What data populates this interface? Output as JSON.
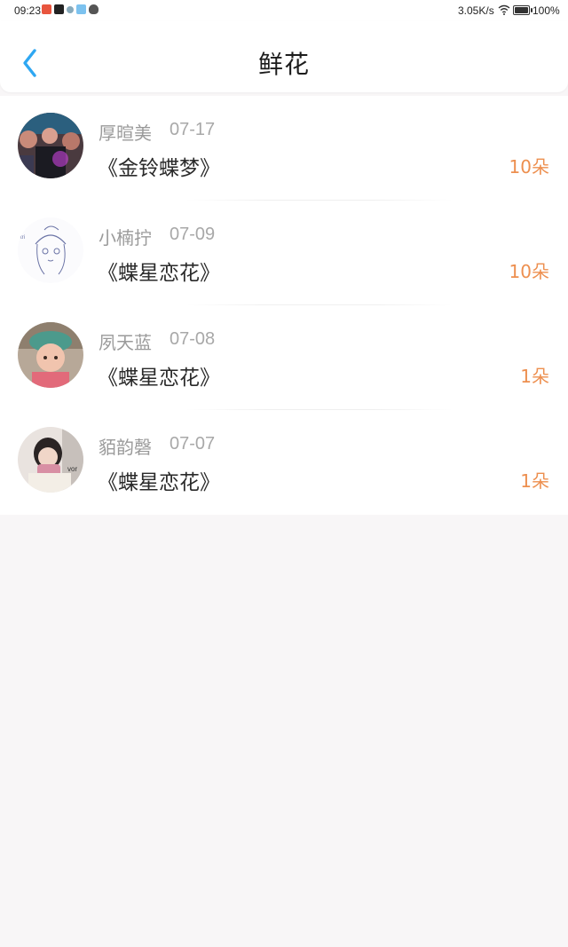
{
  "status_bar": {
    "time": "09:23",
    "net_speed": "3.05K/s",
    "battery": "100%",
    "notification_icons": [
      "app-notification-icon",
      "tv-icon",
      "chat-icon",
      "weather-icon",
      "qq-icon"
    ]
  },
  "header": {
    "title": "鲜花",
    "back_icon": "chevron-left-icon",
    "accent_color": "#2ea7f2"
  },
  "gifts": [
    {
      "name": "厚暄美",
      "date": "07-17",
      "title": "《金铃蝶梦》",
      "count": "10朵"
    },
    {
      "name": "小楠拧",
      "date": "07-09",
      "title": "《蝶星恋花》",
      "count": "10朵"
    },
    {
      "name": "夙天蓝",
      "date": "07-08",
      "title": "《蝶星恋花》",
      "count": "1朵"
    },
    {
      "name": "貊韵磬",
      "date": "07-07",
      "title": "《蝶星恋花》",
      "count": "1朵"
    }
  ],
  "colors": {
    "count": "#ed8f4f",
    "name": "#9a9a9a",
    "background": "#f8f6f7"
  }
}
